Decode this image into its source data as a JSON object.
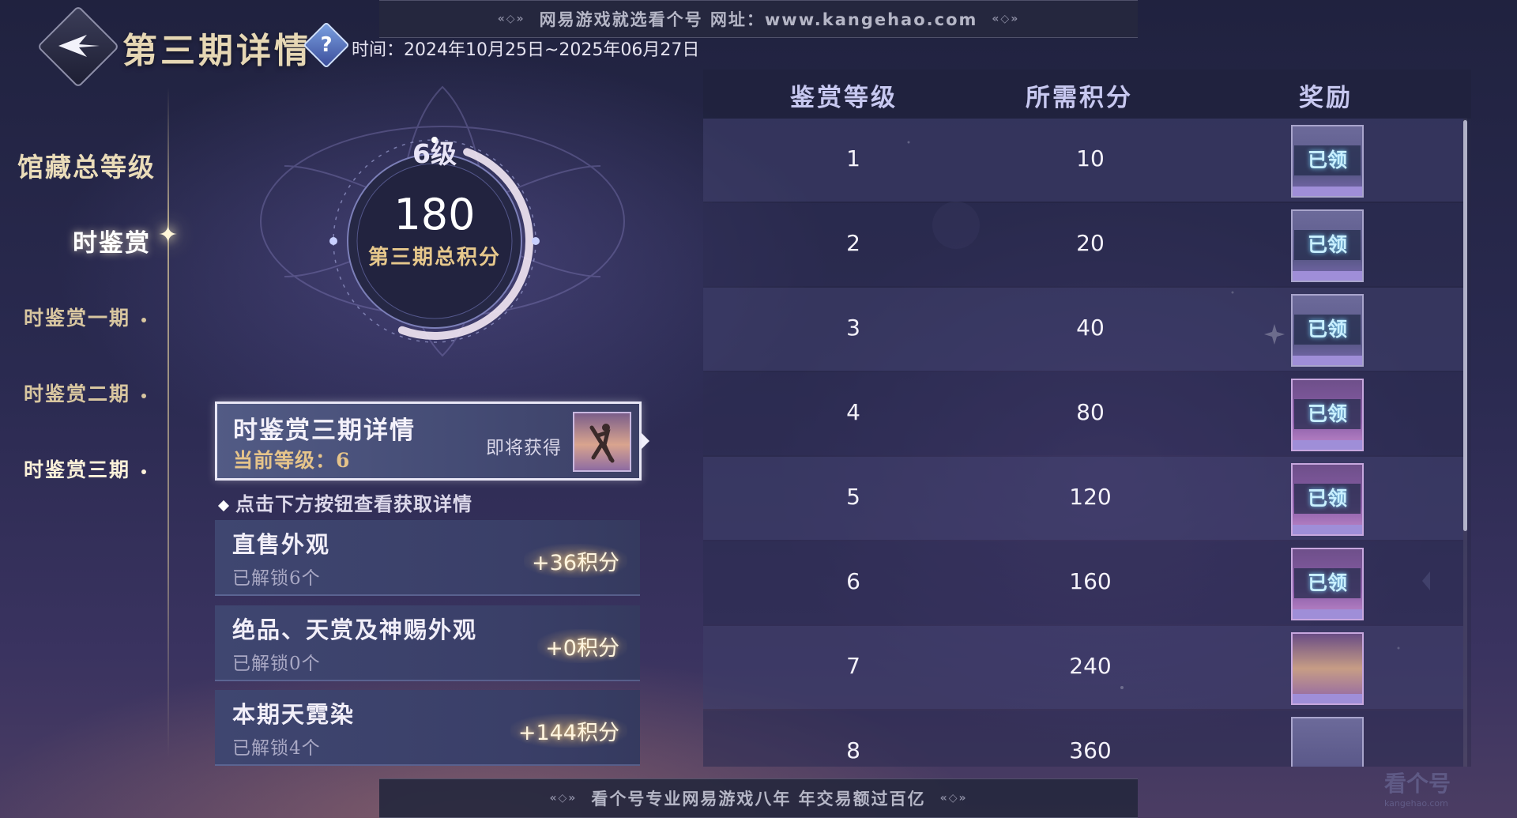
{
  "watermark": {
    "top_text": "网易游戏就选看个号   网址：www.kangehao.com",
    "bottom_text": "看个号专业网易游戏八年   年交易额过百亿",
    "corner_logo": "看个号",
    "corner_url": "kangehao.com"
  },
  "header": {
    "title": "第三期详情",
    "help_symbol": "?",
    "time": "时间：2024年10月25日~2025年06月27日"
  },
  "sidebar": {
    "total_level": "馆藏总等级",
    "section": "时鉴赏",
    "periods": [
      {
        "label": "时鉴赏一期"
      },
      {
        "label": "时鉴赏二期"
      },
      {
        "label": "时鉴赏三期"
      }
    ],
    "active_period": "时鉴赏三期"
  },
  "summary": {
    "level": "6级",
    "total_points": "180",
    "total_label": "第三期总积分",
    "progress_fraction": 0.5
  },
  "detail_card": {
    "title": "时鉴赏三期详情",
    "current_level": "当前等级：6",
    "coming_soon": "即将获得"
  },
  "hint": "点击下方按钮查看获取详情",
  "sources": [
    {
      "name": "直售外观",
      "unlocked": "已解锁6个",
      "points": "+36积分"
    },
    {
      "name": "绝品、天赏及神赐外观",
      "unlocked": "已解锁0个",
      "points": "+0积分"
    },
    {
      "name": "本期天霓染",
      "unlocked": "已解锁4个",
      "points": "+144积分"
    }
  ],
  "table": {
    "headers": {
      "level": "鉴赏等级",
      "points": "所需积分",
      "reward": "奖励"
    },
    "rows": [
      {
        "level": "1",
        "points": "10",
        "status": "已领",
        "style": "plain"
      },
      {
        "level": "2",
        "points": "20",
        "status": "已领",
        "style": "plain"
      },
      {
        "level": "3",
        "points": "40",
        "status": "已领",
        "style": "plain"
      },
      {
        "level": "4",
        "points": "80",
        "status": "已领",
        "style": "pink"
      },
      {
        "level": "5",
        "points": "120",
        "status": "已领",
        "style": "pink"
      },
      {
        "level": "6",
        "points": "160",
        "status": "已领",
        "style": "pink"
      },
      {
        "level": "7",
        "points": "240",
        "status": "",
        "style": "gold"
      },
      {
        "level": "8",
        "points": "360",
        "status": "",
        "style": "plain"
      }
    ]
  },
  "colors": {
    "accent_gold": "#e6c48a",
    "claimed_text": "#c9f0ff",
    "header_text": "#c7c8f0"
  }
}
